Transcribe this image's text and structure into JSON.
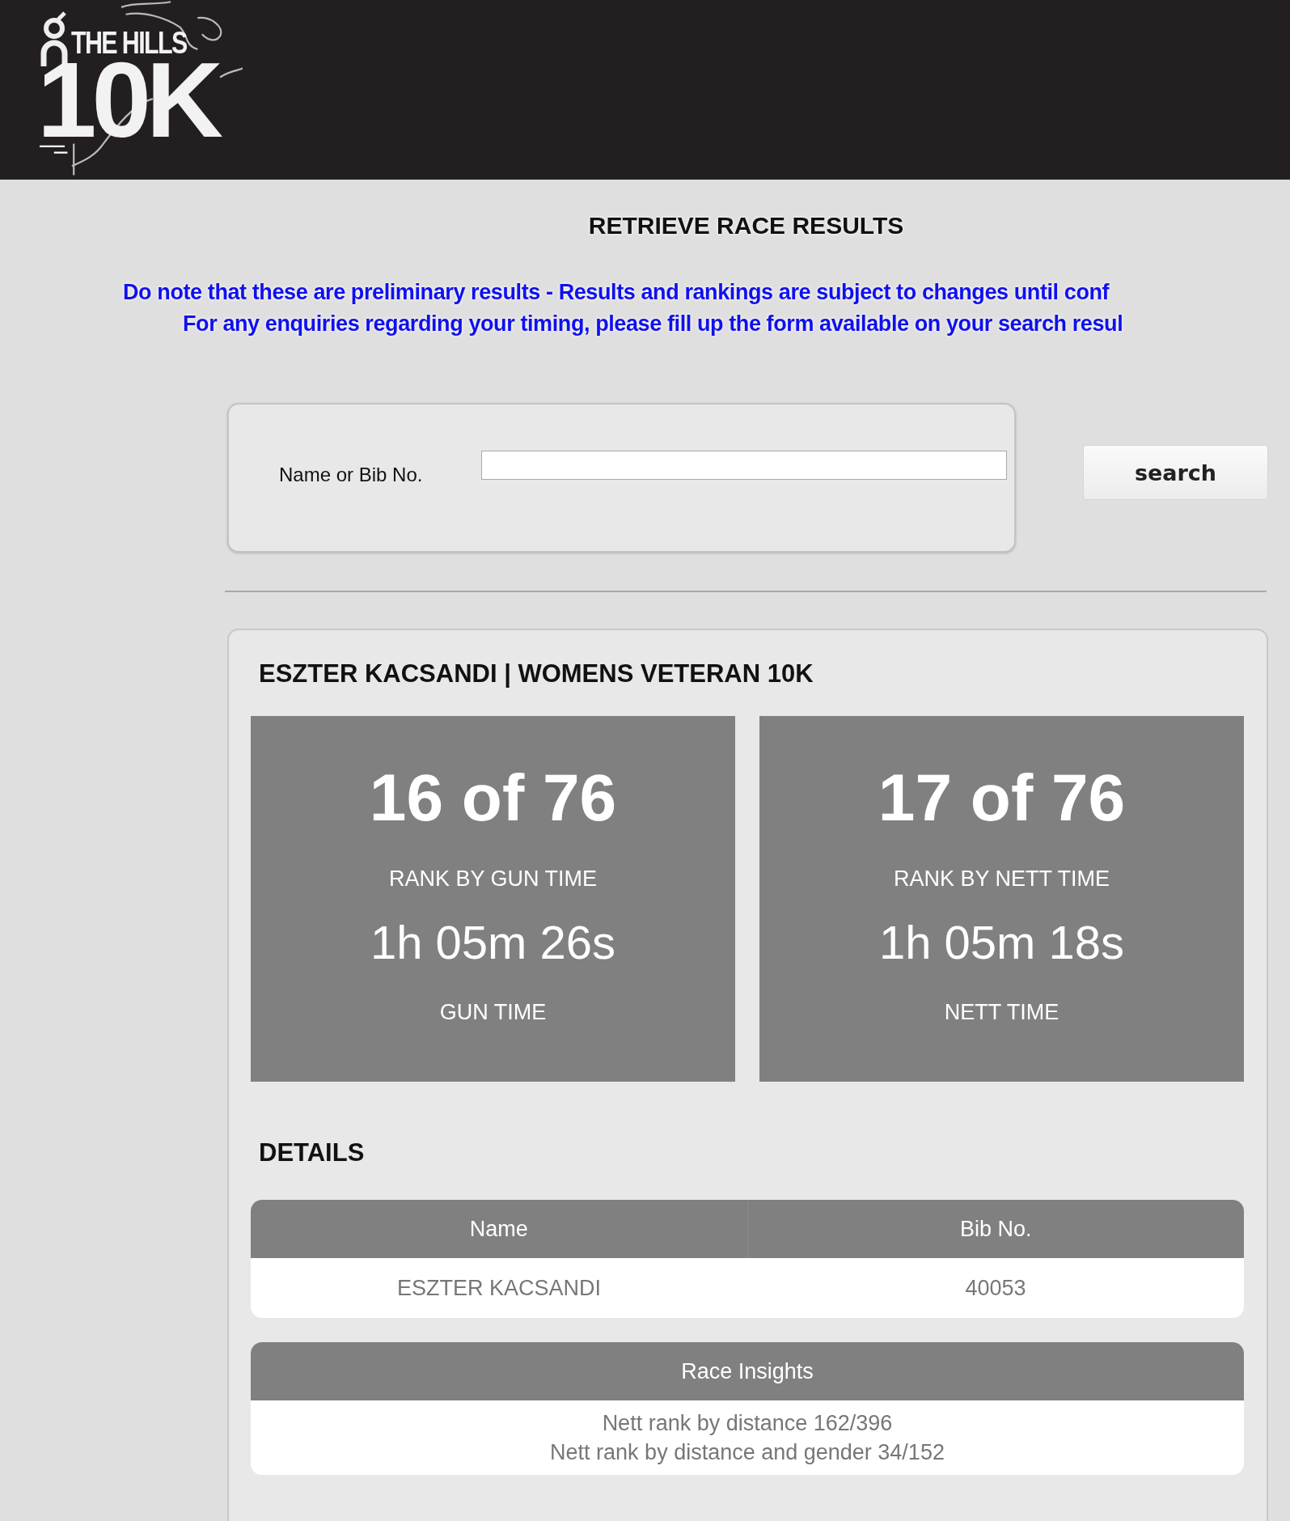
{
  "header": {
    "logo": {
      "line_1": "THE HILLS",
      "line_2": "10K"
    }
  },
  "page_title": "RETRIEVE RACE RESULTS",
  "notices": [
    "Do note that these are preliminary results - Results and rankings are subject to changes until conf",
    "For any enquiries regarding your timing, please fill up the form available on your search resul"
  ],
  "search": {
    "label": "Name or Bib No.",
    "button": "search"
  },
  "result": {
    "title": "ESZTER KACSANDI | WOMENS VETERAN 10K",
    "stats": [
      {
        "rank": "16 of 76",
        "rank_label": "RANK BY GUN TIME",
        "time": "1h 05m 26s",
        "time_label": "GUN TIME"
      },
      {
        "rank": "17 of 76",
        "rank_label": "RANK BY NETT TIME",
        "time": "1h 05m 18s",
        "time_label": "NETT TIME"
      }
    ],
    "details_heading": "DETAILS",
    "details_table": {
      "columns": [
        "Name",
        "Bib No."
      ],
      "rows": [
        [
          "ESZTER KACSANDI",
          "40053"
        ]
      ]
    },
    "insights": {
      "heading": "Race Insights",
      "lines": [
        "Nett rank by distance 162/396",
        "Nett rank by distance and gender 34/152"
      ]
    }
  }
}
